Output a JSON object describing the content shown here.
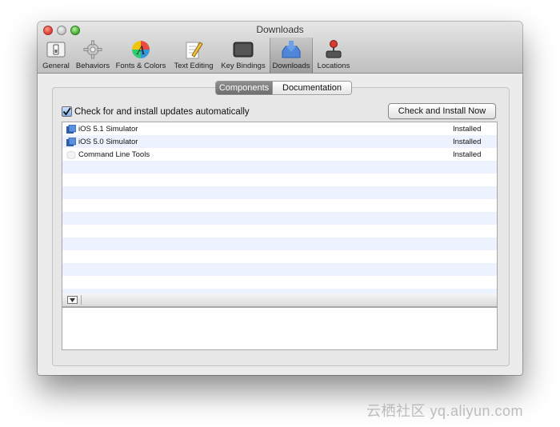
{
  "window": {
    "title": "Downloads",
    "accent": "#3b7ad9"
  },
  "toolbar": {
    "items": [
      {
        "label": "General",
        "icon": "general-switch-icon"
      },
      {
        "label": "Behaviors",
        "icon": "gear-icon"
      },
      {
        "label": "Fonts & Colors",
        "icon": "font-color-icon"
      },
      {
        "label": "Text Editing",
        "icon": "pencil-paper-icon"
      },
      {
        "label": "Key Bindings",
        "icon": "keyboard-icon"
      },
      {
        "label": "Downloads",
        "icon": "download-tray-icon",
        "selected": true
      },
      {
        "label": "Locations",
        "icon": "joystick-icon"
      }
    ]
  },
  "tabs": [
    {
      "label": "Components",
      "active": true
    },
    {
      "label": "Documentation",
      "active": false
    }
  ],
  "auto_update": {
    "label": "Check for and install updates automatically",
    "checked": true
  },
  "check_button_label": "Check and Install Now",
  "components": [
    {
      "name": "iOS 5.1 Simulator",
      "status": "Installed",
      "icon": "simulator-icon"
    },
    {
      "name": "iOS 5.0 Simulator",
      "status": "Installed",
      "icon": "simulator-icon"
    },
    {
      "name": "Command Line Tools",
      "status": "Installed",
      "icon": "package-icon"
    }
  ],
  "watermark": "云栖社区 yq.aliyun.com"
}
